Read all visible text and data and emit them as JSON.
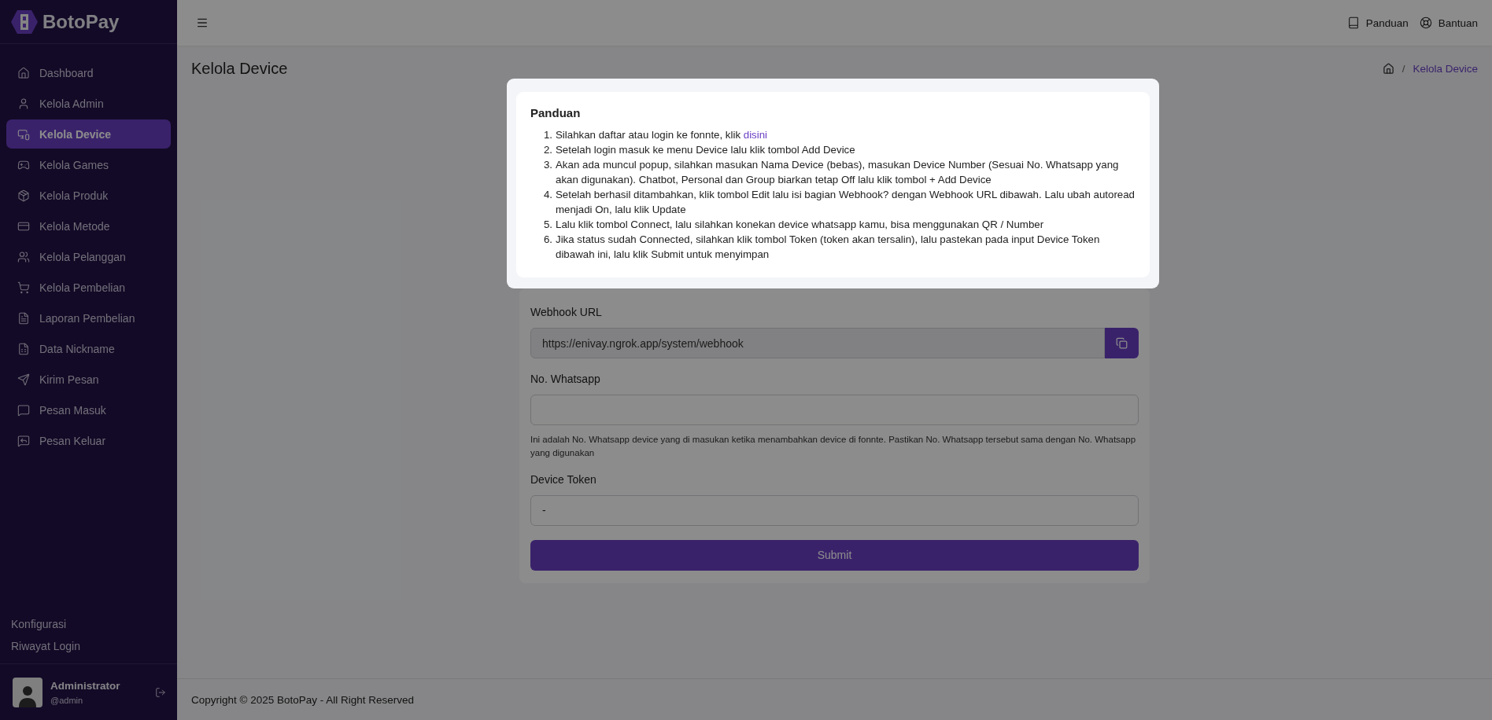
{
  "sidebar": {
    "logo": "BotoPay",
    "items": [
      {
        "label": "Dashboard",
        "selected": false
      },
      {
        "label": "Kelola Admin",
        "selected": false
      },
      {
        "label": "Kelola Device",
        "selected": true
      },
      {
        "label": "Kelola Games",
        "selected": false
      },
      {
        "label": "Kelola Produk",
        "selected": false
      },
      {
        "label": "Kelola Metode",
        "selected": false
      },
      {
        "label": "Kelola Pelanggan",
        "selected": false
      },
      {
        "label": "Kelola Pembelian",
        "selected": false
      },
      {
        "label": "Laporan Pembelian",
        "selected": false
      },
      {
        "label": "Data Nickname",
        "selected": false
      },
      {
        "label": "Kirim Pesan",
        "selected": false
      },
      {
        "label": "Pesan Masuk",
        "selected": false
      },
      {
        "label": "Pesan Keluar",
        "selected": false
      }
    ],
    "bottom_links": [
      "Konfigurasi",
      "Riwayat Login"
    ],
    "user": {
      "name": "Administrator",
      "handle": "@admin"
    }
  },
  "header": {
    "links": [
      "Panduan",
      "Bantuan"
    ]
  },
  "page": {
    "title": "Kelola Device",
    "breadcrumb_separator": "/",
    "breadcrumb": "Kelola Device"
  },
  "form": {
    "fields": [
      {
        "label": "Webhook URL",
        "value": "https://enivay.ngrok.app/system/webhook",
        "kind": "copy"
      },
      {
        "label": "No. Whatsapp",
        "kind": "text",
        "help": "Ini adalah No. Whatsapp device yang di masukan ketika menambahkan device di fonnte. Pastikan No. Whatsapp tersebut sama dengan No. Whatsapp yang digunakan"
      },
      {
        "label": "Device Token",
        "value": "-",
        "kind": "text"
      }
    ],
    "submit": "Submit"
  },
  "modal": {
    "title": "Panduan",
    "steps": [
      {
        "number": "1.",
        "text": "Silahkan daftar atau login ke fonnte, klik ",
        "link": "disini"
      },
      {
        "number": "2.",
        "text": "Setelah login masuk ke menu Device lalu klik tombol Add Device"
      },
      {
        "number": "3.",
        "text": "Akan ada muncul popup, silahkan masukan Nama Device (bebas), masukan Device Number (Sesuai No. Whatsapp yang akan digunakan). Chatbot, Personal dan Group biarkan tetap Off lalu klik tombol + Add Device"
      },
      {
        "number": "4.",
        "text": "Setelah berhasil ditambahkan, klik tombol Edit lalu isi bagian Webhook? dengan Webhook URL dibawah. Lalu ubah autoread menjadi On, lalu klik Update"
      },
      {
        "number": "5.",
        "text": "Lalu klik tombol Connect, lalu silahkan konekan device whatsapp kamu, bisa menggunakan QR / Number"
      },
      {
        "number": "6.",
        "text": "Jika status sudah Connected, silahkan klik tombol Token (token akan tersalin), lalu pastekan pada input Device Token dibawah ini, lalu klik Submit untuk menyimpan"
      }
    ]
  },
  "footer": "Copyright © 2025 BotoPay - All Right Reserved"
}
